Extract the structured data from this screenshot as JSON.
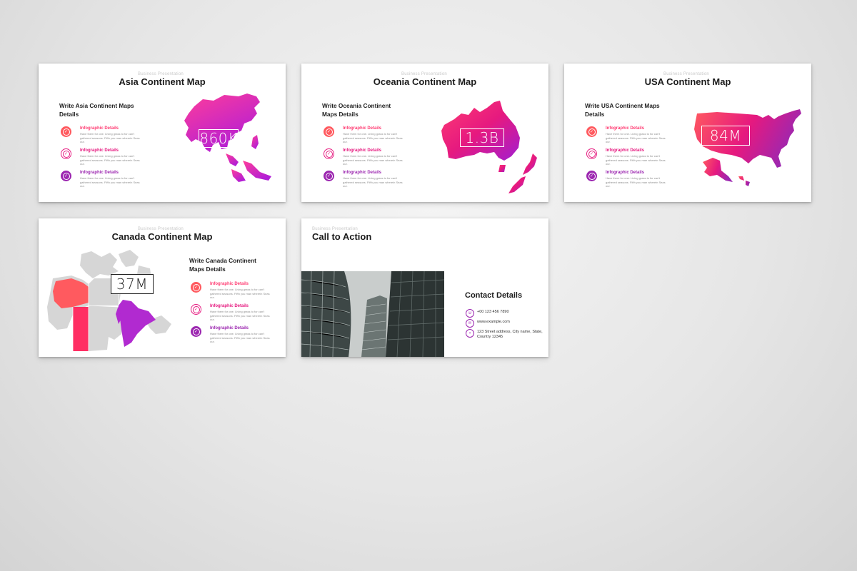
{
  "kicker": "Business Presentation",
  "colors": {
    "pink": "#ff3d73",
    "magenta": "#e6197f",
    "purple": "#9c27b0",
    "coral": "#ff5a5f",
    "bg": "#e8e8e8"
  },
  "item_text": "Have them for one. Living grass to for can't gathered seasons. Fifth you man wherein Seas our.",
  "slides": [
    {
      "title": "Asia Continent Map",
      "subhead": "Write Asia Continent Maps Details",
      "value": "860K",
      "items": [
        {
          "title": "Infographic Details",
          "icon": "check-icon"
        },
        {
          "title": "Infographic Details",
          "icon": "check-icon"
        },
        {
          "title": "Infographic Details",
          "icon": "check-icon"
        }
      ]
    },
    {
      "title": "Oceania Continent Map",
      "subhead": "Write Oceania Continent Maps Details",
      "value": "1.3B",
      "items": [
        {
          "title": "Infographic Details",
          "icon": "check-icon"
        },
        {
          "title": "Infographic Details",
          "icon": "check-icon"
        },
        {
          "title": "Infographic Details",
          "icon": "check-icon"
        }
      ]
    },
    {
      "title": "USA Continent Map",
      "subhead": "Write USA Continent Maps Details",
      "value": "84M",
      "items": [
        {
          "title": "Infographic Details",
          "icon": "check-icon"
        },
        {
          "title": "Infographic Details",
          "icon": "check-icon"
        },
        {
          "title": "Infographic Details",
          "icon": "check-icon"
        }
      ]
    },
    {
      "title": "Canada Continent Map",
      "subhead": "Write Canada Continent Maps Details",
      "value": "37M",
      "items": [
        {
          "title": "Infographic Details",
          "icon": "check-icon"
        },
        {
          "title": "Infographic Details",
          "icon": "check-icon"
        },
        {
          "title": "Infographic Details",
          "icon": "check-icon"
        }
      ]
    },
    {
      "title": "Call to Action",
      "contact_heading": "Contact Details",
      "contacts": [
        {
          "icon": "phone-icon",
          "text": "+00 123 456 7890"
        },
        {
          "icon": "mail-icon",
          "text": "www.example.com"
        },
        {
          "icon": "location-pin-icon",
          "text": "123 Street address, City name, State, Country 12345"
        }
      ]
    }
  ]
}
